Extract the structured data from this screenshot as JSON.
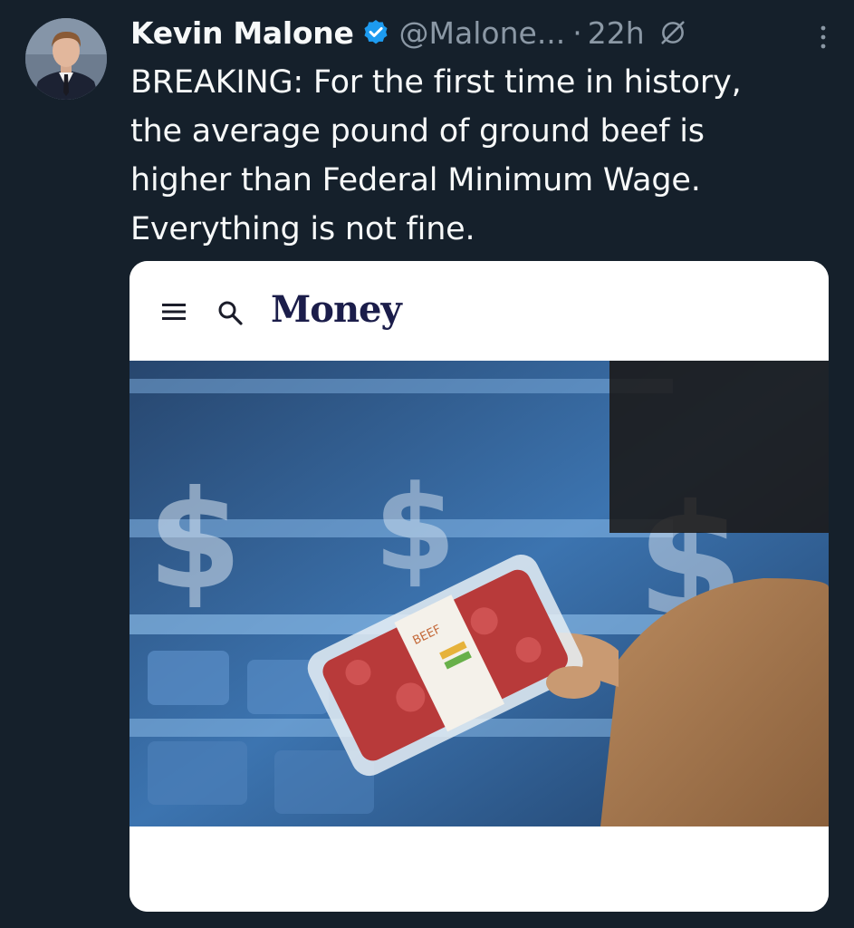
{
  "tweet": {
    "author_name": "Kevin Malone",
    "handle": "@Malone...",
    "separator": "·",
    "time_ago": "22h",
    "text_lines": [
      "BREAKING: For the first time in history,",
      "the average pound of ground beef is",
      "higher than Federal Minimum Wage.",
      "Everything is not fine."
    ]
  },
  "media": {
    "site_name": "Money",
    "package_label": "BEEF"
  },
  "icons": {
    "verified": "verified-badge-icon",
    "grok": "grok-icon",
    "more": "more-options-icon",
    "menu": "hamburger-menu-icon",
    "search": "search-icon"
  },
  "colors": {
    "background": "#15202b",
    "primary_text": "#f7f9f9",
    "secondary_text": "#8b98a5",
    "verified_blue": "#1d9bf0",
    "money_logo": "#1b1d4a"
  }
}
